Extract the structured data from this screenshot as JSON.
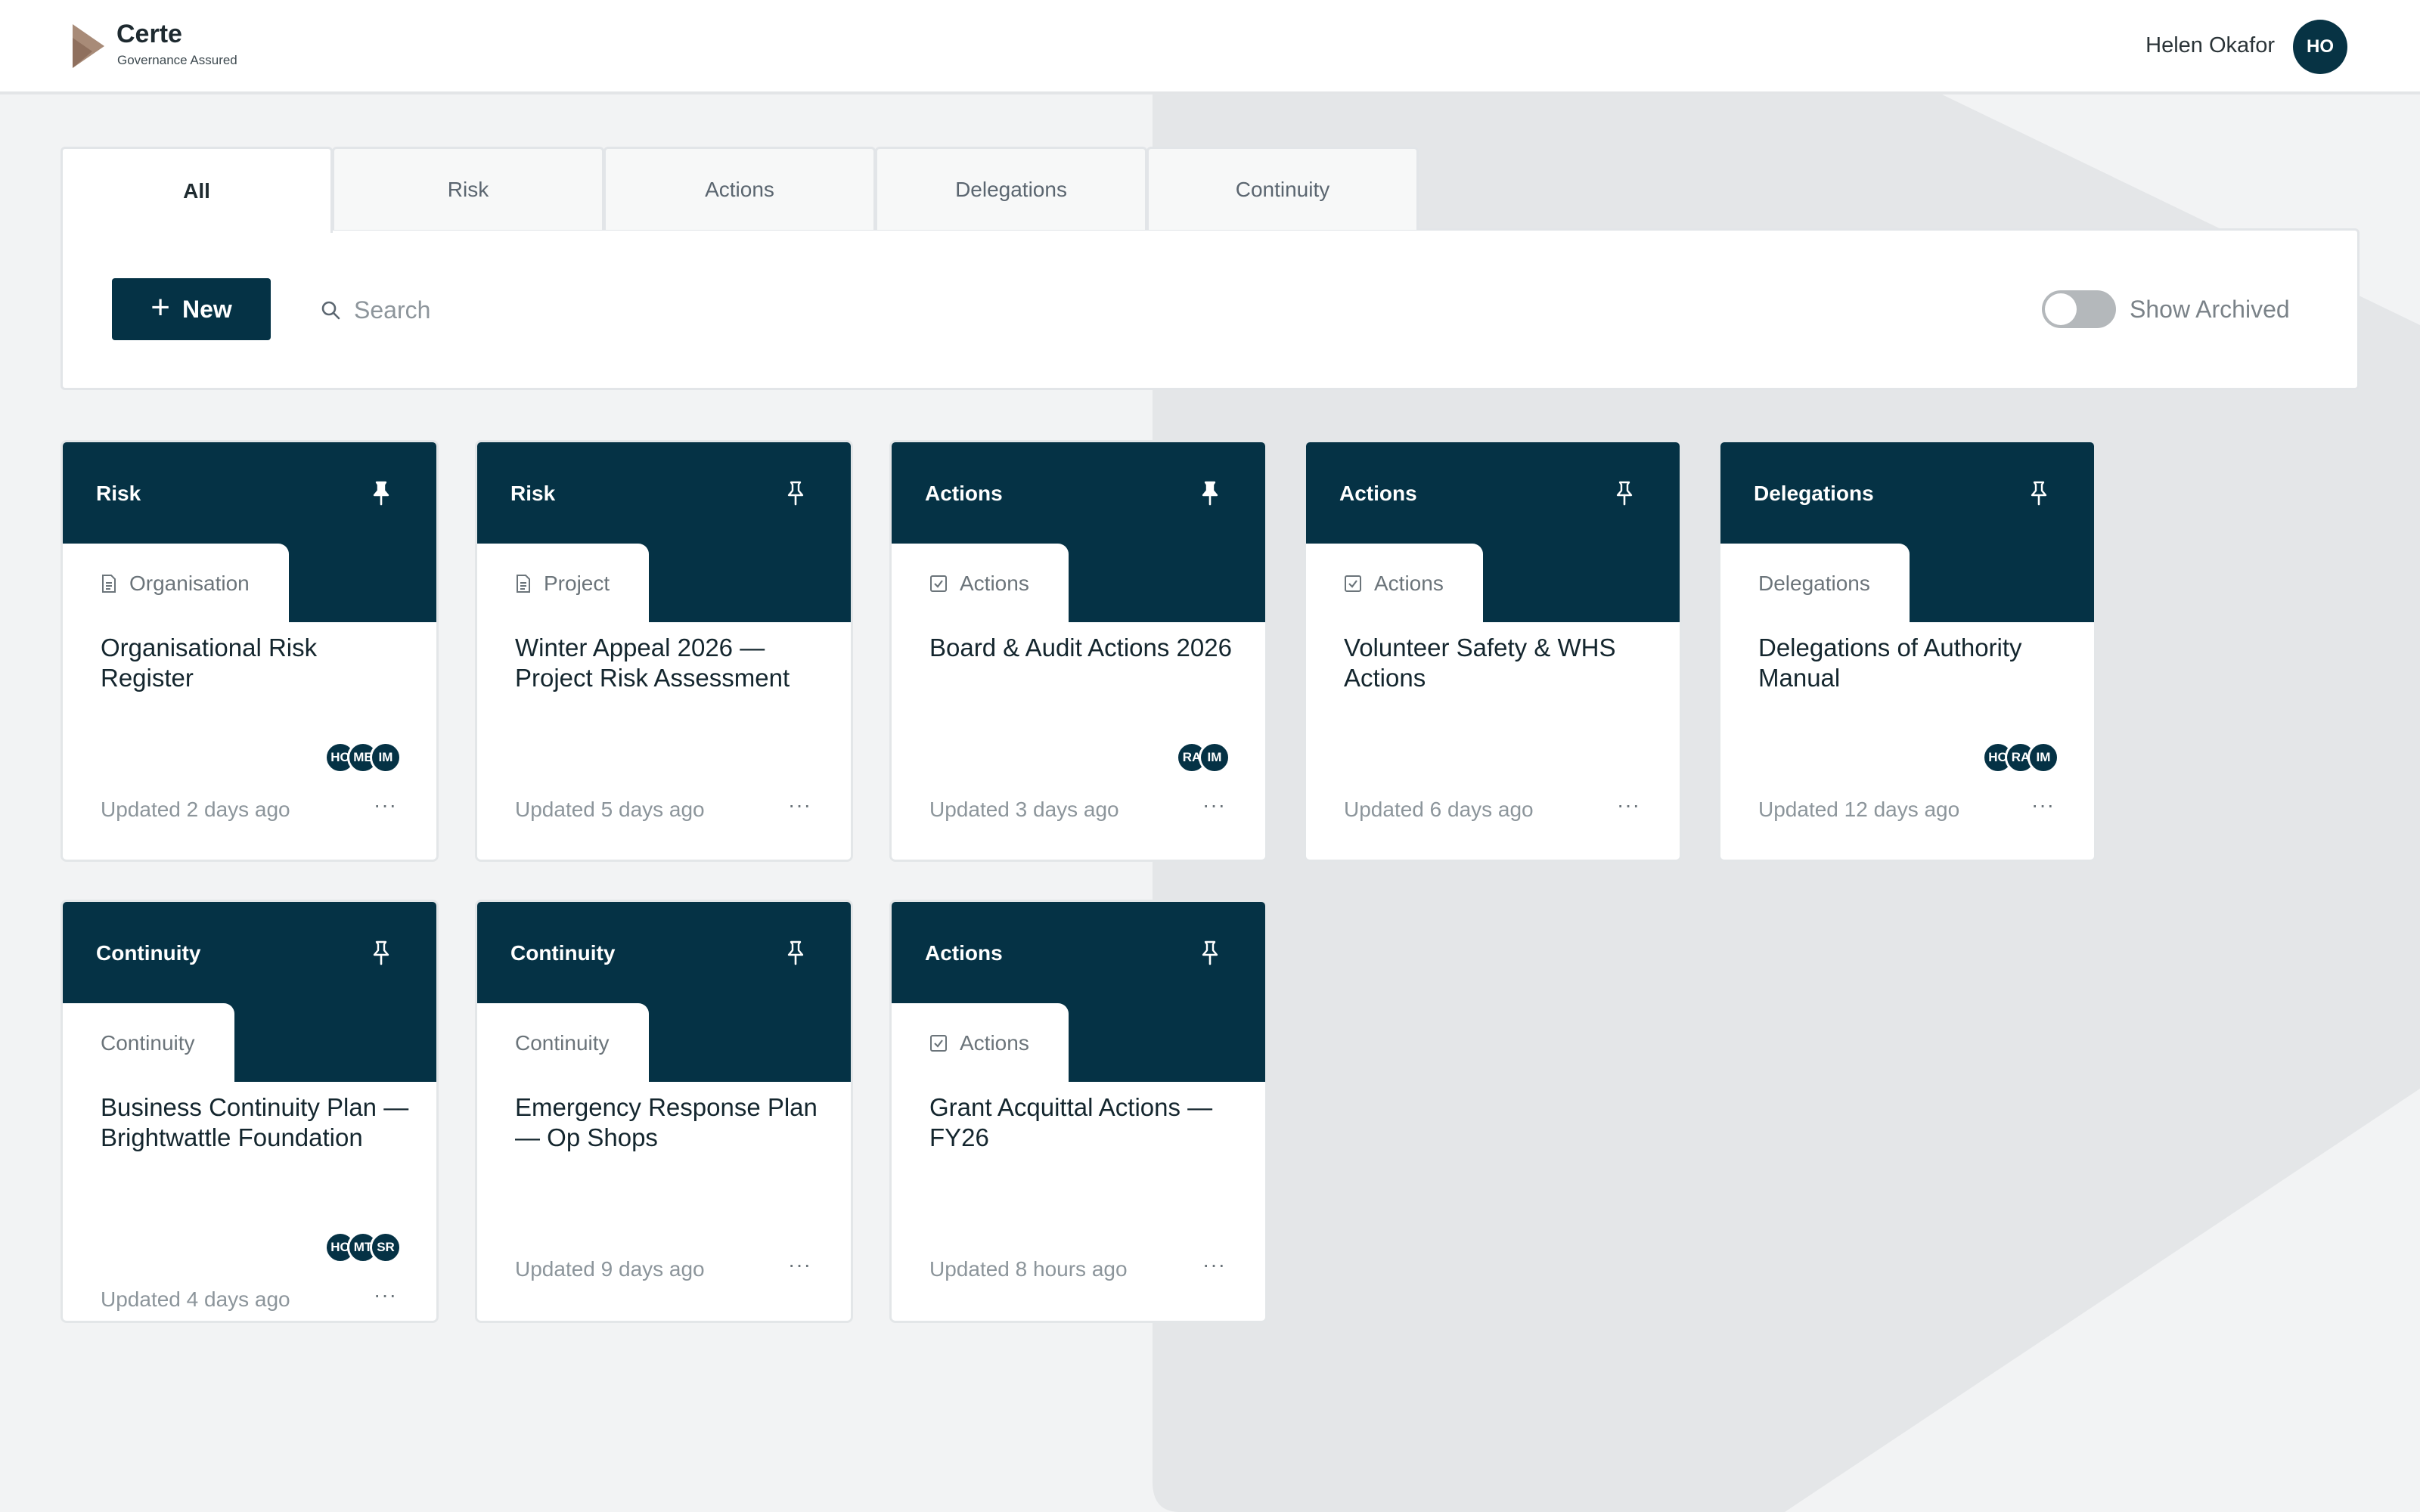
{
  "app": {
    "name": "Certe",
    "tagline": "Governance Assured"
  },
  "user": {
    "name": "Helen Okafor",
    "initials": "HO"
  },
  "tabs": [
    {
      "label": "All",
      "active": true
    },
    {
      "label": "Risk",
      "active": false
    },
    {
      "label": "Actions",
      "active": false
    },
    {
      "label": "Delegations",
      "active": false
    },
    {
      "label": "Continuity",
      "active": false
    }
  ],
  "toolbar": {
    "new_label": "New",
    "search_placeholder": "Search",
    "archived_label": "Show Archived",
    "archived_on": false
  },
  "cards": [
    {
      "type": "Risk",
      "tag": "Organisation",
      "tag_icon": "document-icon",
      "title": "Organisational Risk Register",
      "avatars": [
        "HO",
        "ME",
        "IM"
      ],
      "updated": "Updated 2 days ago",
      "pinned": true
    },
    {
      "type": "Risk",
      "tag": "Project",
      "tag_icon": "document-icon",
      "title": "Winter Appeal 2026 — Project Risk Assessment",
      "avatars": [],
      "updated": "Updated 5 days ago",
      "pinned": false
    },
    {
      "type": "Actions",
      "tag": "Actions",
      "tag_icon": "checkbox-icon",
      "title": "Board & Audit Actions 2026",
      "avatars": [
        "RA",
        "IM"
      ],
      "updated": "Updated 3 days ago",
      "pinned": true
    },
    {
      "type": "Actions",
      "tag": "Actions",
      "tag_icon": "checkbox-icon",
      "title": "Volunteer Safety & WHS Actions",
      "avatars": [],
      "updated": "Updated 6 days ago",
      "pinned": false
    },
    {
      "type": "Delegations",
      "tag": "Delegations",
      "tag_icon": "",
      "title": "Delegations of Authority Manual",
      "avatars": [
        "HO",
        "RA",
        "IM"
      ],
      "updated": "Updated 12 days ago",
      "pinned": false
    },
    {
      "type": "Continuity",
      "tag": "Continuity",
      "tag_icon": "",
      "title": "Business Continuity Plan — Brightwattle Foundation",
      "avatars": [
        "HO",
        "MT",
        "SR"
      ],
      "updated": "Updated 4 days ago",
      "pinned": false
    },
    {
      "type": "Continuity",
      "tag": "Continuity",
      "tag_icon": "",
      "title": "Emergency Response Plan — Op Shops",
      "avatars": [],
      "updated": "Updated 9 days ago",
      "pinned": false
    },
    {
      "type": "Actions",
      "tag": "Actions",
      "tag_icon": "checkbox-icon",
      "title": "Grant Acquittal Actions — FY26",
      "avatars": [],
      "updated": "Updated 8 hours ago",
      "pinned": false
    }
  ],
  "more_label": "···",
  "colors": {
    "primary": "#053245",
    "background": "#f2f3f4",
    "card": "#ffffff",
    "logo": "#a07e6a"
  }
}
